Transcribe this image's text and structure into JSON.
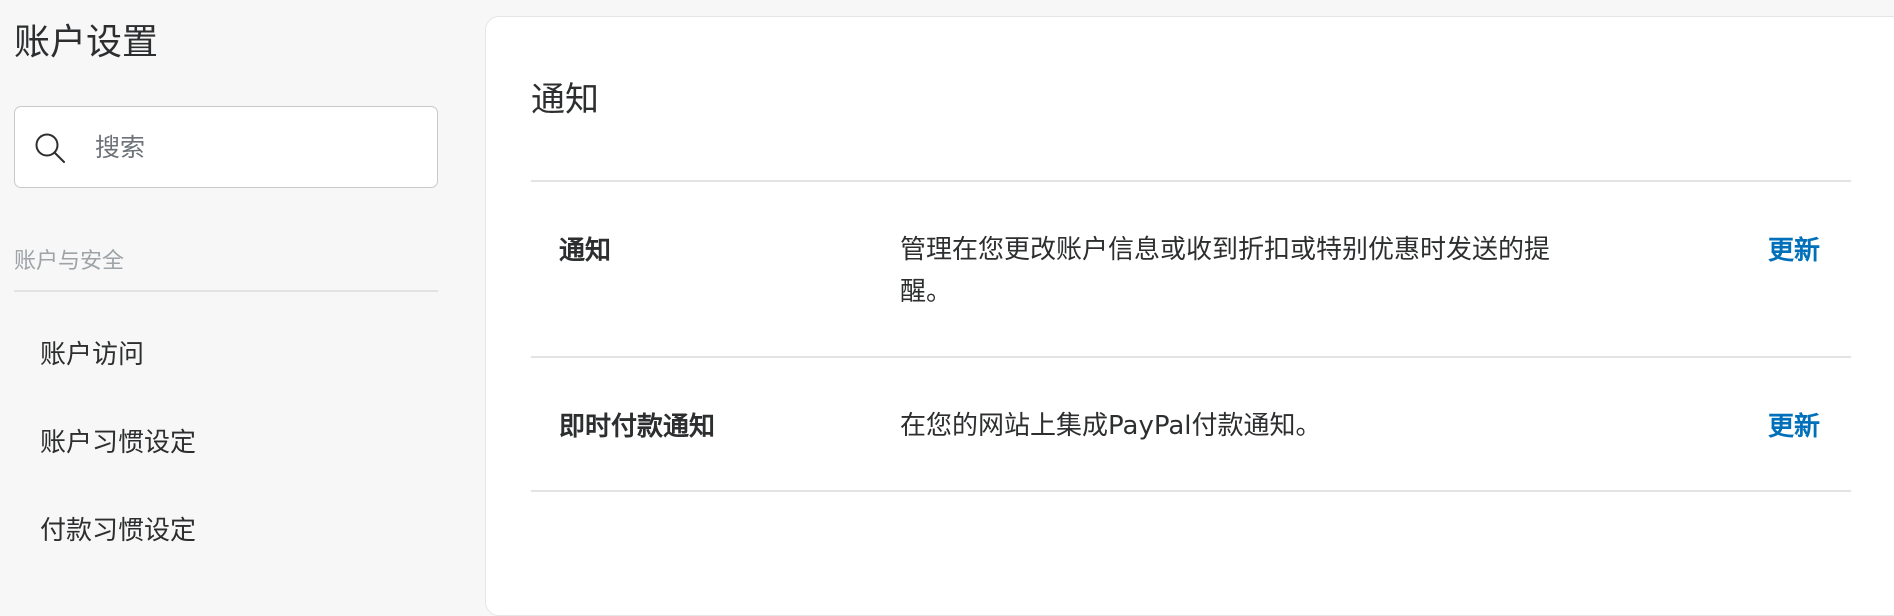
{
  "sidebar": {
    "title": "账户设置",
    "search": {
      "placeholder": "搜索",
      "value": ""
    },
    "section_label": "账户与安全",
    "items": [
      {
        "label": "账户访问"
      },
      {
        "label": "账户习惯设定"
      },
      {
        "label": "付款习惯设定"
      }
    ]
  },
  "main": {
    "title": "通知",
    "rows": [
      {
        "label": "通知",
        "description": "管理在您更改账户信息或收到折扣或特别优惠时发送的提醒。",
        "action": "更新"
      },
      {
        "label": "即时付款通知",
        "description": "在您的网站上集成PayPal付款通知。",
        "action": "更新"
      }
    ]
  },
  "colors": {
    "link": "#0070ba",
    "background": "#f7f7f7",
    "panel": "#ffffff",
    "muted_text": "#9da3a6"
  },
  "icons": {
    "search": "search-icon"
  }
}
